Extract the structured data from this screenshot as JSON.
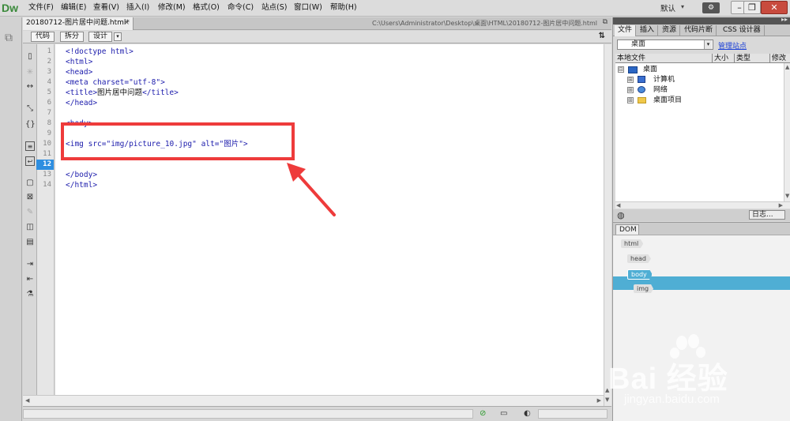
{
  "app": {
    "logo": "Dw"
  },
  "menu": [
    "文件(F)",
    "编辑(E)",
    "查看(V)",
    "插入(I)",
    "修改(M)",
    "格式(O)",
    "命令(C)",
    "站点(S)",
    "窗口(W)",
    "帮助(H)"
  ],
  "workspace": {
    "preset": "默认"
  },
  "document": {
    "tab_title": "20180712-图片居中问题.html*",
    "path": "C:\\Users\\Administrator\\Desktop\\桌面\\HTML\\20180712-图片居中问题.html"
  },
  "view_buttons": {
    "code": "代码",
    "split": "拆分",
    "design": "设计"
  },
  "code_lines": [
    {
      "n": "1",
      "text": "<!doctype html>"
    },
    {
      "n": "2",
      "text": "<html>"
    },
    {
      "n": "3",
      "text": "<head>"
    },
    {
      "n": "4",
      "text": "<meta charset=\"utf-8\">"
    },
    {
      "n": "5",
      "pre": "<title>",
      "zh": "图片居中问题",
      "post": "</title>"
    },
    {
      "n": "6",
      "text": "</head>"
    },
    {
      "n": "7",
      "text": ""
    },
    {
      "n": "8",
      "text": "<body>"
    },
    {
      "n": "9",
      "text": ""
    },
    {
      "n": "10",
      "pre": "<img src=\"img/picture_10.jpg\" alt=\"",
      "zh": "图片",
      "post": "\">"
    },
    {
      "n": "11",
      "text": ""
    },
    {
      "n": "12",
      "text": ""
    },
    {
      "n": "13",
      "text": "</body>"
    },
    {
      "n": "14",
      "text": "</html>"
    }
  ],
  "active_line": "12",
  "files_panel": {
    "tabs": [
      "文件",
      "插入",
      "资源",
      "代码片断",
      "CSS 设计器"
    ],
    "site": "桌面",
    "manage_sites": "管理站点",
    "columns": [
      "本地文件",
      "大小",
      "类型",
      "修改"
    ],
    "tree": [
      {
        "label": "桌面",
        "level": 0,
        "toggle": "⊟"
      },
      {
        "label": "计算机",
        "level": 1,
        "toggle": "⊞"
      },
      {
        "label": "网络",
        "level": 1,
        "toggle": "⊞"
      },
      {
        "label": "桌面项目",
        "level": 1,
        "toggle": "⊞"
      }
    ],
    "log_button": "日志..."
  },
  "dom_panel": {
    "tab": "DOM",
    "nodes": [
      {
        "label": "html",
        "indent": 0
      },
      {
        "label": "head",
        "indent": 1
      },
      {
        "label": "body",
        "indent": 1,
        "selected": true
      },
      {
        "label": "img",
        "indent": 2
      }
    ]
  },
  "watermark": {
    "brand": "Bai 经验",
    "url": "jingyan.baidu.com"
  },
  "colors": {
    "annotation_red": "#ee3b3b",
    "accent_blue": "#2e8ee0",
    "dom_selected": "#4faed4"
  }
}
